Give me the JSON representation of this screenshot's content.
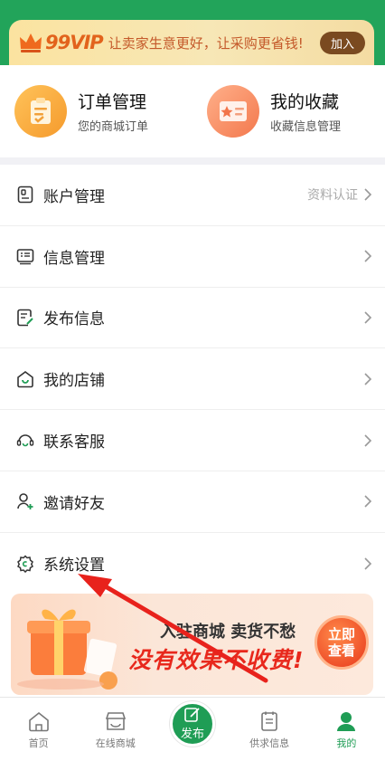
{
  "vip": {
    "brand": "99VIP",
    "slogan": "让卖家生意更好，让采购更省钱!",
    "join_label": "加入"
  },
  "quick_links": [
    {
      "title": "订单管理",
      "subtitle": "您的商城订单"
    },
    {
      "title": "我的收藏",
      "subtitle": "收藏信息管理"
    }
  ],
  "menu": [
    {
      "label": "账户管理",
      "extra": "资料认证",
      "icon": "account-card-icon"
    },
    {
      "label": "信息管理",
      "extra": "",
      "icon": "info-list-icon"
    },
    {
      "label": "发布信息",
      "extra": "",
      "icon": "edit-document-icon"
    },
    {
      "label": "我的店铺",
      "extra": "",
      "icon": "shop-house-icon"
    },
    {
      "label": "联系客服",
      "extra": "",
      "icon": "headset-icon"
    },
    {
      "label": "邀请好友",
      "extra": "",
      "icon": "add-user-icon"
    },
    {
      "label": "系统设置",
      "extra": "",
      "icon": "settings-gear-icon"
    }
  ],
  "promo": {
    "line1": "入驻商城 卖货不愁",
    "line2": "没有效果不收费!",
    "button": "立即\n查看"
  },
  "tabs": [
    {
      "label": "首页",
      "icon": "home-icon",
      "active": false
    },
    {
      "label": "在线商城",
      "icon": "store-icon",
      "active": false
    },
    {
      "label": "发布",
      "icon": "publish-icon",
      "active": false
    },
    {
      "label": "供求信息",
      "icon": "clipboard-icon",
      "active": false
    },
    {
      "label": "我的",
      "icon": "user-icon",
      "active": true
    }
  ],
  "colors": {
    "brand_green": "#1f9d55",
    "vip_orange": "#e2631c",
    "promo_red": "#e8281c",
    "annotation_arrow": "#e8221c"
  }
}
